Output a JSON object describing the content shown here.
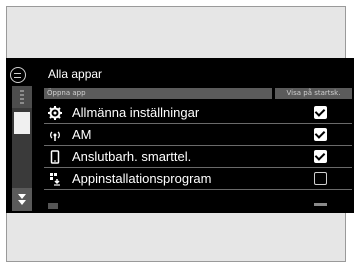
{
  "header": {
    "title": "Alla appar"
  },
  "columns": {
    "app": "Öppna app",
    "show": "Visa på startsk."
  },
  "rows": [
    {
      "label": "Allmänna inställningar",
      "icon": "gear-icon",
      "checked": true
    },
    {
      "label": "AM",
      "icon": "radio-antenna-icon",
      "checked": true
    },
    {
      "label": "Anslutbarh. smarttel.",
      "icon": "smartphone-icon",
      "checked": true
    },
    {
      "label": "Appinstallationsprogram",
      "icon": "app-installer-icon",
      "checked": false
    }
  ],
  "colors": {
    "screen_bg": "#000000",
    "frame_bg": "#e6e6e6",
    "text": "#ffffff"
  }
}
